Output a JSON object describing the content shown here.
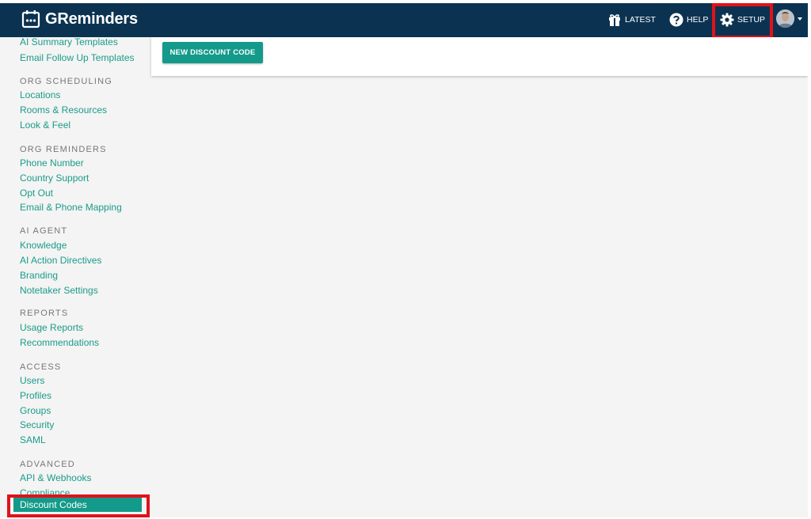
{
  "header": {
    "brand": "GReminders",
    "latest_label": "LATEST",
    "help_label": "HELP",
    "setup_label": "SETUP",
    "colors": {
      "background": "#0b3351",
      "accent": "#149a8a",
      "highlight": "#e0121b"
    }
  },
  "sidebar": {
    "partial_items": [
      "AI Summary Templates",
      "Email Follow Up Templates"
    ],
    "sections": [
      {
        "heading": "ORG SCHEDULING",
        "items": [
          "Locations",
          "Rooms & Resources",
          "Look & Feel"
        ]
      },
      {
        "heading": "ORG REMINDERS",
        "items": [
          "Phone Number",
          "Country Support",
          "Opt Out",
          "Email & Phone Mapping"
        ]
      },
      {
        "heading": "AI AGENT",
        "items": [
          "Knowledge",
          "AI Action Directives",
          "Branding",
          "Notetaker Settings"
        ]
      },
      {
        "heading": "REPORTS",
        "items": [
          "Usage Reports",
          "Recommendations"
        ]
      },
      {
        "heading": "ACCESS",
        "items": [
          "Users",
          "Profiles",
          "Groups",
          "Security",
          "SAML"
        ]
      },
      {
        "heading": "ADVANCED",
        "items": [
          "API & Webhooks",
          "Compliance"
        ]
      }
    ],
    "active_item": "Discount Codes"
  },
  "main": {
    "new_discount_label": "NEW DISCOUNT CODE"
  }
}
